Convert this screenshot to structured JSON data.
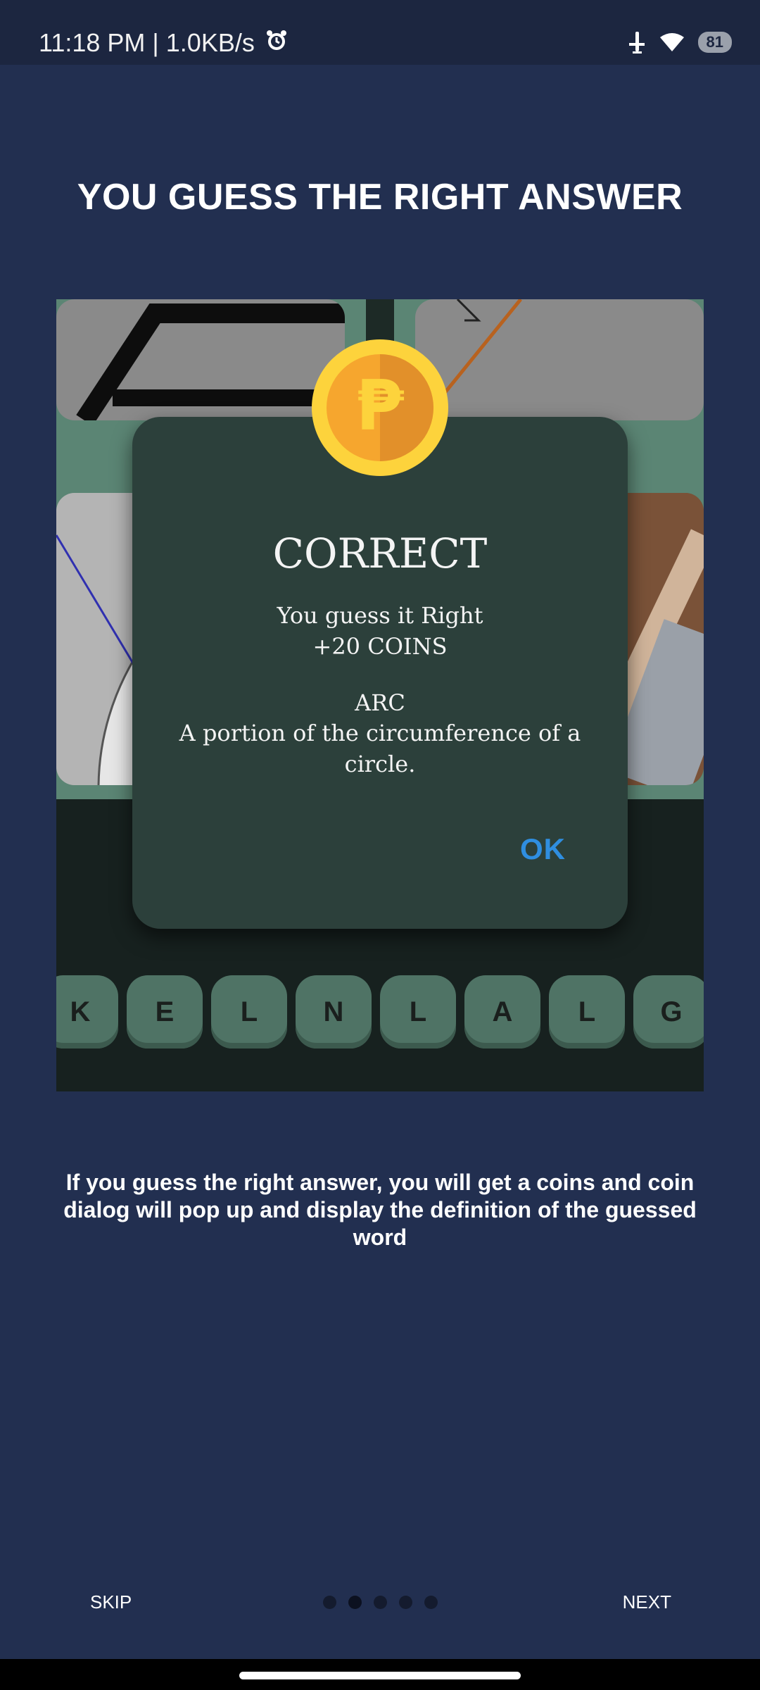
{
  "status": {
    "time": "11:18 PM | 1.0KB/s",
    "battery": "81",
    "icons": [
      "alarm-icon",
      "airplane-icon",
      "wifi-icon",
      "battery-icon"
    ]
  },
  "page": {
    "title": "YOU GUESS THE RIGHT ANSWER",
    "caption": "If you guess the right answer, you will get a coins and coin dialog will pop up and display the definition of the guessed word"
  },
  "preview": {
    "keys": [
      "K",
      "E",
      "L",
      "N",
      "L",
      "A",
      "L",
      "G"
    ],
    "dialog": {
      "title": "CORRECT",
      "line1": "You guess it Right",
      "line2": "+20 COINS",
      "word": "ARC",
      "definition": "A portion of the circumference of a circle.",
      "ok_label": "OK",
      "coin_symbol": "₱"
    },
    "colors": {
      "dialog_bg": "#2c403b",
      "ok": "#2f8ee0",
      "coin": "#f6a62e"
    }
  },
  "nav": {
    "skip_label": "SKIP",
    "next_label": "NEXT",
    "page_count": 5,
    "active_page": 2
  }
}
